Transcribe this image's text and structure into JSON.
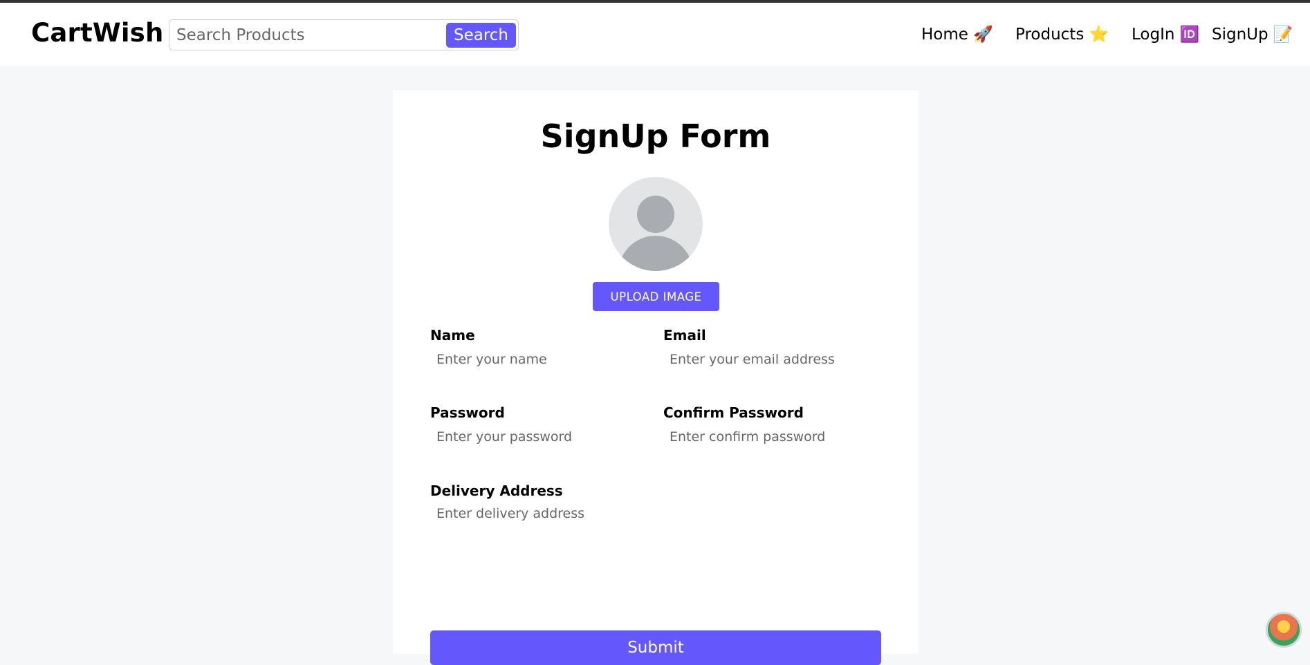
{
  "navbar": {
    "brand": "CartWish",
    "search": {
      "placeholder": "Search Products",
      "button": "Search"
    },
    "links": [
      {
        "label": "Home 🚀"
      },
      {
        "label": "Products ⭐"
      },
      {
        "label": "LogIn 🆔"
      },
      {
        "label": "SignUp 📝"
      }
    ]
  },
  "form": {
    "title": "SignUp Form",
    "upload_button": "UPLOAD IMAGE",
    "fields": {
      "name": {
        "label": "Name",
        "placeholder": "Enter your name"
      },
      "email": {
        "label": "Email",
        "placeholder": "Enter your email address"
      },
      "password": {
        "label": "Password",
        "placeholder": "Enter your password"
      },
      "confirm_password": {
        "label": "Confirm Password",
        "placeholder": "Enter confirm password"
      },
      "delivery_address": {
        "label": "Delivery Address",
        "placeholder": "Enter delivery address"
      }
    },
    "submit_button": "Submit"
  },
  "icons": {
    "avatar": "user-avatar-icon",
    "corner_badge": "beach-app-icon"
  },
  "colors": {
    "accent": "#6457fb",
    "page_bg": "#f6f7f9",
    "card_bg": "#ffffff"
  }
}
